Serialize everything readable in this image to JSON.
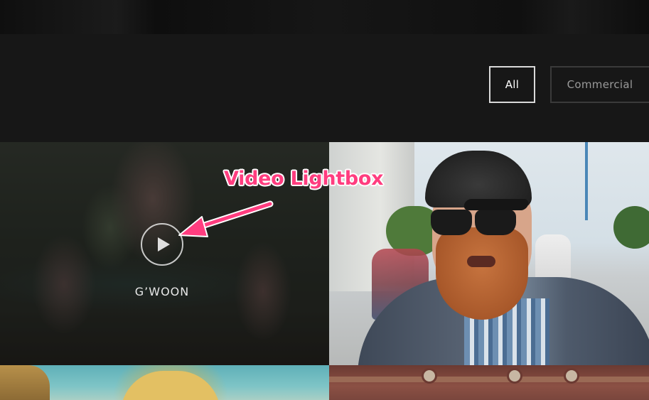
{
  "filters": {
    "items": [
      {
        "label": "All",
        "active": true
      },
      {
        "label": "Commercial",
        "active": false
      }
    ]
  },
  "portfolio": {
    "tiles": [
      {
        "title": "G’WOON",
        "type": "video",
        "icon": "play-icon"
      },
      {
        "title": "",
        "type": "video"
      },
      {
        "title": "",
        "type": "video"
      },
      {
        "title": "",
        "type": "video"
      }
    ]
  },
  "annotation": {
    "label": "Video Lightbox",
    "color": "#ff3d7f"
  }
}
